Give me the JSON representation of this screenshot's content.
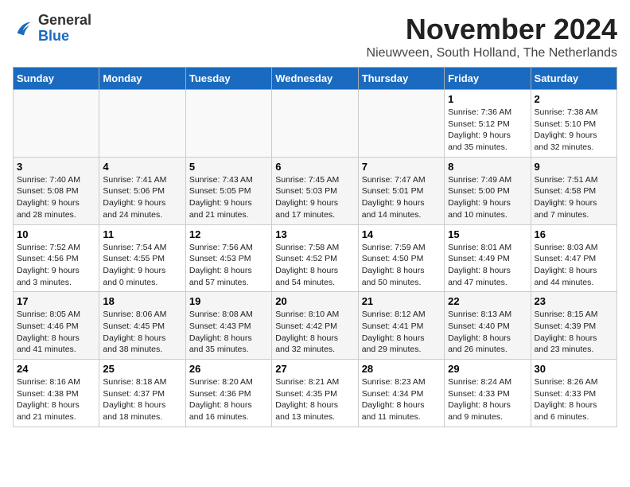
{
  "logo": {
    "general": "General",
    "blue": "Blue"
  },
  "title": "November 2024",
  "subtitle": "Nieuwveen, South Holland, The Netherlands",
  "weekdays": [
    "Sunday",
    "Monday",
    "Tuesday",
    "Wednesday",
    "Thursday",
    "Friday",
    "Saturday"
  ],
  "weeks": [
    [
      {
        "day": "",
        "info": ""
      },
      {
        "day": "",
        "info": ""
      },
      {
        "day": "",
        "info": ""
      },
      {
        "day": "",
        "info": ""
      },
      {
        "day": "",
        "info": ""
      },
      {
        "day": "1",
        "info": "Sunrise: 7:36 AM\nSunset: 5:12 PM\nDaylight: 9 hours\nand 35 minutes."
      },
      {
        "day": "2",
        "info": "Sunrise: 7:38 AM\nSunset: 5:10 PM\nDaylight: 9 hours\nand 32 minutes."
      }
    ],
    [
      {
        "day": "3",
        "info": "Sunrise: 7:40 AM\nSunset: 5:08 PM\nDaylight: 9 hours\nand 28 minutes."
      },
      {
        "day": "4",
        "info": "Sunrise: 7:41 AM\nSunset: 5:06 PM\nDaylight: 9 hours\nand 24 minutes."
      },
      {
        "day": "5",
        "info": "Sunrise: 7:43 AM\nSunset: 5:05 PM\nDaylight: 9 hours\nand 21 minutes."
      },
      {
        "day": "6",
        "info": "Sunrise: 7:45 AM\nSunset: 5:03 PM\nDaylight: 9 hours\nand 17 minutes."
      },
      {
        "day": "7",
        "info": "Sunrise: 7:47 AM\nSunset: 5:01 PM\nDaylight: 9 hours\nand 14 minutes."
      },
      {
        "day": "8",
        "info": "Sunrise: 7:49 AM\nSunset: 5:00 PM\nDaylight: 9 hours\nand 10 minutes."
      },
      {
        "day": "9",
        "info": "Sunrise: 7:51 AM\nSunset: 4:58 PM\nDaylight: 9 hours\nand 7 minutes."
      }
    ],
    [
      {
        "day": "10",
        "info": "Sunrise: 7:52 AM\nSunset: 4:56 PM\nDaylight: 9 hours\nand 3 minutes."
      },
      {
        "day": "11",
        "info": "Sunrise: 7:54 AM\nSunset: 4:55 PM\nDaylight: 9 hours\nand 0 minutes."
      },
      {
        "day": "12",
        "info": "Sunrise: 7:56 AM\nSunset: 4:53 PM\nDaylight: 8 hours\nand 57 minutes."
      },
      {
        "day": "13",
        "info": "Sunrise: 7:58 AM\nSunset: 4:52 PM\nDaylight: 8 hours\nand 54 minutes."
      },
      {
        "day": "14",
        "info": "Sunrise: 7:59 AM\nSunset: 4:50 PM\nDaylight: 8 hours\nand 50 minutes."
      },
      {
        "day": "15",
        "info": "Sunrise: 8:01 AM\nSunset: 4:49 PM\nDaylight: 8 hours\nand 47 minutes."
      },
      {
        "day": "16",
        "info": "Sunrise: 8:03 AM\nSunset: 4:47 PM\nDaylight: 8 hours\nand 44 minutes."
      }
    ],
    [
      {
        "day": "17",
        "info": "Sunrise: 8:05 AM\nSunset: 4:46 PM\nDaylight: 8 hours\nand 41 minutes."
      },
      {
        "day": "18",
        "info": "Sunrise: 8:06 AM\nSunset: 4:45 PM\nDaylight: 8 hours\nand 38 minutes."
      },
      {
        "day": "19",
        "info": "Sunrise: 8:08 AM\nSunset: 4:43 PM\nDaylight: 8 hours\nand 35 minutes."
      },
      {
        "day": "20",
        "info": "Sunrise: 8:10 AM\nSunset: 4:42 PM\nDaylight: 8 hours\nand 32 minutes."
      },
      {
        "day": "21",
        "info": "Sunrise: 8:12 AM\nSunset: 4:41 PM\nDaylight: 8 hours\nand 29 minutes."
      },
      {
        "day": "22",
        "info": "Sunrise: 8:13 AM\nSunset: 4:40 PM\nDaylight: 8 hours\nand 26 minutes."
      },
      {
        "day": "23",
        "info": "Sunrise: 8:15 AM\nSunset: 4:39 PM\nDaylight: 8 hours\nand 23 minutes."
      }
    ],
    [
      {
        "day": "24",
        "info": "Sunrise: 8:16 AM\nSunset: 4:38 PM\nDaylight: 8 hours\nand 21 minutes."
      },
      {
        "day": "25",
        "info": "Sunrise: 8:18 AM\nSunset: 4:37 PM\nDaylight: 8 hours\nand 18 minutes."
      },
      {
        "day": "26",
        "info": "Sunrise: 8:20 AM\nSunset: 4:36 PM\nDaylight: 8 hours\nand 16 minutes."
      },
      {
        "day": "27",
        "info": "Sunrise: 8:21 AM\nSunset: 4:35 PM\nDaylight: 8 hours\nand 13 minutes."
      },
      {
        "day": "28",
        "info": "Sunrise: 8:23 AM\nSunset: 4:34 PM\nDaylight: 8 hours\nand 11 minutes."
      },
      {
        "day": "29",
        "info": "Sunrise: 8:24 AM\nSunset: 4:33 PM\nDaylight: 8 hours\nand 9 minutes."
      },
      {
        "day": "30",
        "info": "Sunrise: 8:26 AM\nSunset: 4:33 PM\nDaylight: 8 hours\nand 6 minutes."
      }
    ]
  ]
}
